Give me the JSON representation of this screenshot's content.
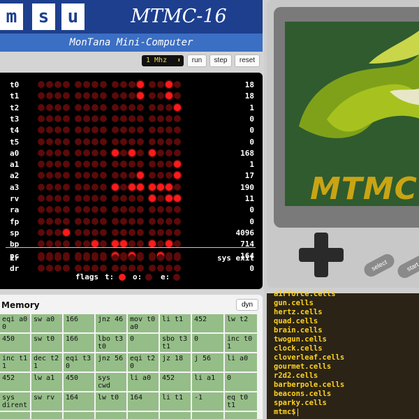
{
  "header": {
    "logo_letters": [
      "m",
      "s",
      "u"
    ],
    "title": "MTMC-16",
    "subtitle": "MonTana Mini-Computer",
    "brand_color": "#1d3f8e"
  },
  "controls": {
    "speed": "1 Mhz",
    "run_label": "run",
    "step_label": "step",
    "reset_label": "reset"
  },
  "registers": [
    {
      "name": "t0",
      "value": "18"
    },
    {
      "name": "t1",
      "value": "18"
    },
    {
      "name": "t2",
      "value": "1"
    },
    {
      "name": "t3",
      "value": "0"
    },
    {
      "name": "t4",
      "value": "0"
    },
    {
      "name": "t5",
      "value": "0"
    },
    {
      "name": "a0",
      "value": "168"
    },
    {
      "name": "a1",
      "value": "1"
    },
    {
      "name": "a2",
      "value": "17"
    },
    {
      "name": "a3",
      "value": "190"
    },
    {
      "name": "rv",
      "value": "11"
    },
    {
      "name": "ra",
      "value": "0"
    },
    {
      "name": "fp",
      "value": "0"
    },
    {
      "name": "sp",
      "value": "4096"
    },
    {
      "name": "bp",
      "value": "714"
    },
    {
      "name": "pc",
      "value": "164"
    }
  ],
  "ir": {
    "name": "ir",
    "value": "sys exit"
  },
  "dr": {
    "name": "dr",
    "value": "0"
  },
  "flags": {
    "label": "flags",
    "t_label": "t:",
    "t_on": true,
    "o_label": "o:",
    "o_on": false,
    "e_label": "e:",
    "e_on": false
  },
  "led_colors": {
    "on": "#ff1a1a",
    "off": "#5c0a0a"
  },
  "memory": {
    "title": "Memory",
    "mode_label": "dyn",
    "cell_color": "#95bd88",
    "rows": [
      [
        "eqi a0\n0",
        "sw a0",
        "166",
        "jnz 46",
        "mov t0\na0",
        "li t1",
        "452",
        "lw t2"
      ],
      [
        "450",
        "sw t0",
        "166",
        "lbo t3\nt0",
        "0",
        "sbo t3\nt1",
        "0",
        "inc t0\n1"
      ],
      [
        "inc t1\n1",
        "dec t2\n1",
        "eqi t3\n0",
        "jnz 56",
        "eqi t2\n0",
        "jz 18",
        "j 56",
        "li a0"
      ],
      [
        "452",
        "lw a1",
        "450",
        "sys\ncwd",
        "li a0",
        "452",
        "li a1",
        "0"
      ],
      [
        "sys\ndirent",
        "sw rv",
        "164",
        "lw t0",
        "164",
        "li t1",
        "-1",
        "eq t0\nt1"
      ],
      [
        "",
        "",
        "",
        "",
        "",
        "",
        "",
        ""
      ]
    ]
  },
  "console": {
    "screen_text": "MTMC",
    "select_label": "select",
    "start_label": "start"
  },
  "terminal": {
    "lines": [
      "airforce.cells",
      "gun.cells",
      "hertz.cells",
      "quad.cells",
      "brain.cells",
      "twogun.cells",
      "clock.cells",
      "cloverleaf.cells",
      "gourmet.cells",
      "r2d2.cells",
      "barberpole.cells",
      "beacons.cells",
      "sparky.cells"
    ],
    "prompt": "mtmc$"
  }
}
